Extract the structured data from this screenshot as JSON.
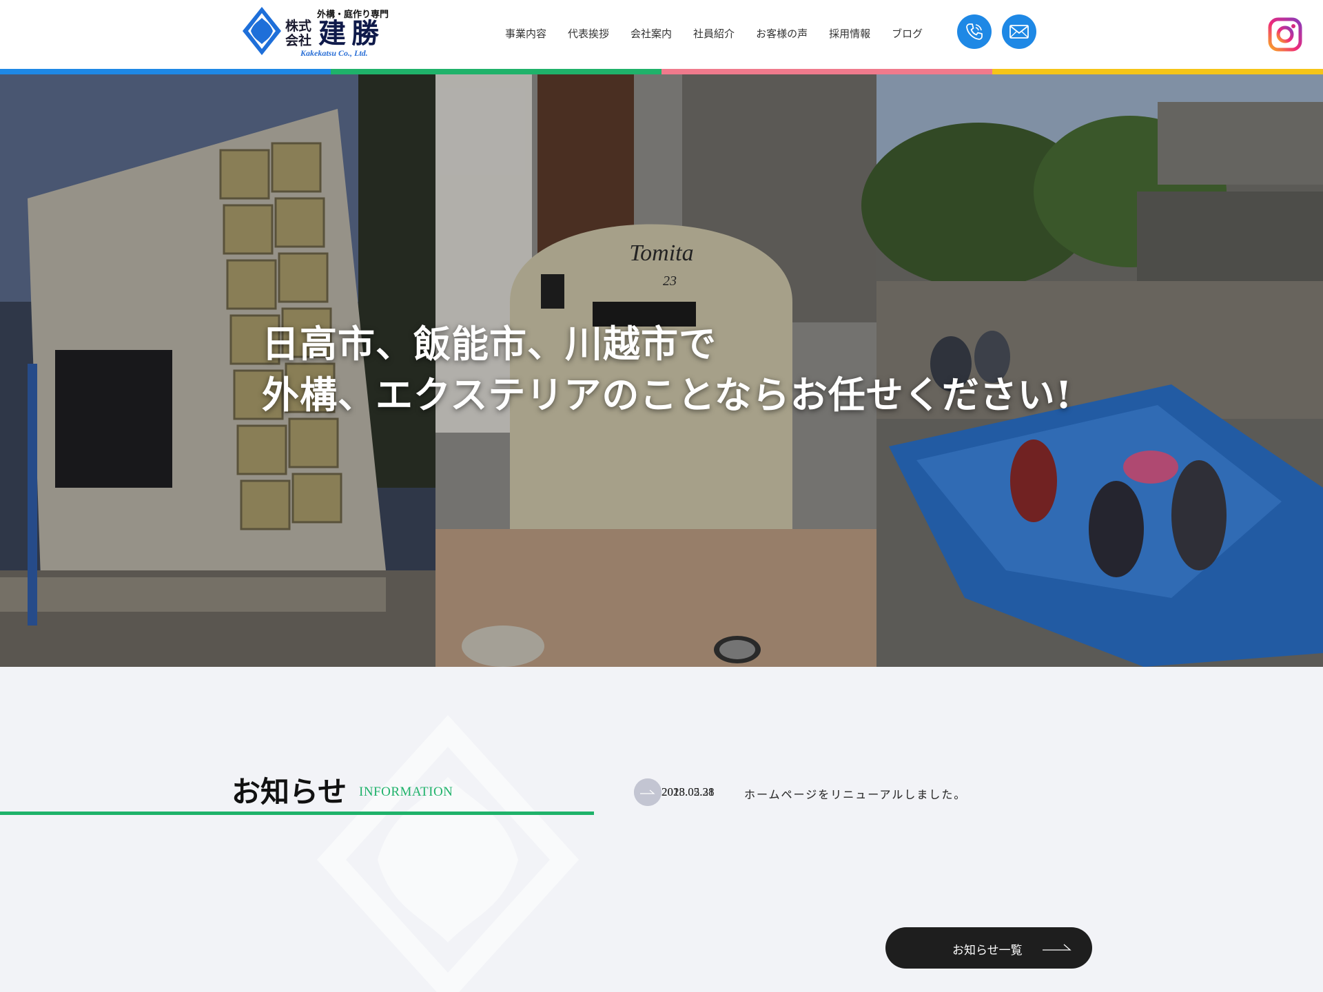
{
  "header": {
    "logo": {
      "kabushiki": "株式会社",
      "tagline": "外構・庭作り専門",
      "name": "建勝",
      "english": "Kakekatsu Co., Ltd."
    },
    "nav": [
      {
        "label": "事業内容"
      },
      {
        "label": "代表挨拶"
      },
      {
        "label": "会社案内"
      },
      {
        "label": "社員紹介"
      },
      {
        "label": "お客様の声"
      },
      {
        "label": "採用情報"
      },
      {
        "label": "ブログ"
      }
    ],
    "icons": {
      "phone": "phone-icon",
      "mail": "mail-icon",
      "instagram": "instagram-icon"
    },
    "color_bar": [
      "#1e88e5",
      "#1fb26a",
      "#f07a8c",
      "#f5c518"
    ]
  },
  "hero": {
    "line1": "日高市、飯能市、川越市で",
    "line2": "外構、エクステリアのことならお任せください!",
    "photo_sign": "Tomita",
    "photo_number": "23"
  },
  "info": {
    "title": "お知らせ",
    "subtitle": "INFORMATION",
    "news": [
      {
        "date": "2023.05.31",
        "text": "ホームページをリニューアルしました。"
      },
      {
        "date": "2018.02.28",
        "text": "ホームページをリニューアルしました。"
      }
    ],
    "more_label": "お知らせ一覧",
    "accent": "#1fb26a"
  }
}
